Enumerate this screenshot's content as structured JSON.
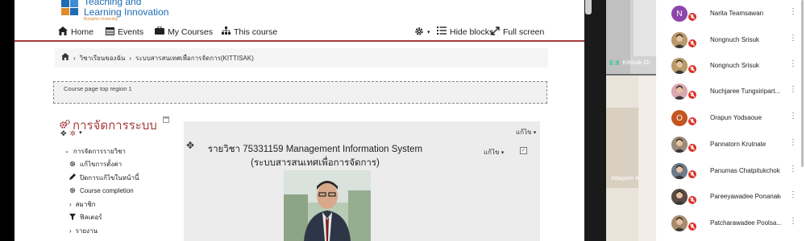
{
  "logo": {
    "line1": "Teaching and",
    "line2": "Learning Innovation",
    "line3": "Burapha University"
  },
  "nav": {
    "home": "Home",
    "events": "Events",
    "my_courses": "My Courses",
    "this_course": "This course",
    "hide_blocks": "Hide blocks",
    "full_screen": "Full screen"
  },
  "breadcrumb": {
    "item1": "วิชาเรียนของฉัน",
    "item2": "ระบบสารสนเทศเพื่อการจัดการ(KITTISAK)"
  },
  "region_label": "Course page top region 1",
  "admin_block": {
    "title": "การจัดการระบบ",
    "items": [
      {
        "label": "การจัดการรายวิชา",
        "icon": "chevron-down-icon"
      },
      {
        "label": "แก้ไขการตั้งค่า",
        "icon": "gear-icon"
      },
      {
        "label": "ปิดการแก้ไขในหน้านี้",
        "icon": "pencil-icon"
      },
      {
        "label": "Course completion",
        "icon": "gear-icon"
      },
      {
        "label": "สมาชิก",
        "icon": "chevron-right-icon"
      },
      {
        "label": "ฟิลเตอร์",
        "icon": "filter-icon"
      },
      {
        "label": "รายงาน",
        "icon": "chevron-right-icon"
      }
    ]
  },
  "course_card": {
    "title_line1": "รายวิชา 75331159 Management Information System",
    "title_line2": "(ระบบสารสนเทศเพื่อการจัดการ)",
    "edit_label": "แก้ไข"
  },
  "video": {
    "tile1_name": "Kittisak Or",
    "tile2_name": "Attaporn K"
  },
  "participants": [
    {
      "name": "Narita Teamsawan",
      "initial": "N",
      "color": "#8e44ad"
    },
    {
      "name": "Nongnuch Srisuk",
      "initial": "",
      "color": "#b89a6a"
    },
    {
      "name": "Nongnuch Srisuk",
      "initial": "",
      "color": "#b89a6a"
    },
    {
      "name": "Nuchjaree Tungsiripart...",
      "initial": "",
      "color": "#d9a7b0"
    },
    {
      "name": "Orapun Yodsaoue",
      "initial": "O",
      "color": "#c2561f"
    },
    {
      "name": "Pannatorn Krutnate",
      "initial": "",
      "color": "#9c8a7a"
    },
    {
      "name": "Panumas Chatpitukchok",
      "initial": "",
      "color": "#6c7a8a"
    },
    {
      "name": "Pareeyawadee Ponanake",
      "initial": "",
      "color": "#5b4a45"
    },
    {
      "name": "Patcharawadee Poolsa...",
      "initial": "",
      "color": "#a88b6e"
    }
  ],
  "colors": {
    "accent_red": "#a63b3b",
    "mute_red": "#d93025",
    "link_blue": "#1c6bb4"
  }
}
